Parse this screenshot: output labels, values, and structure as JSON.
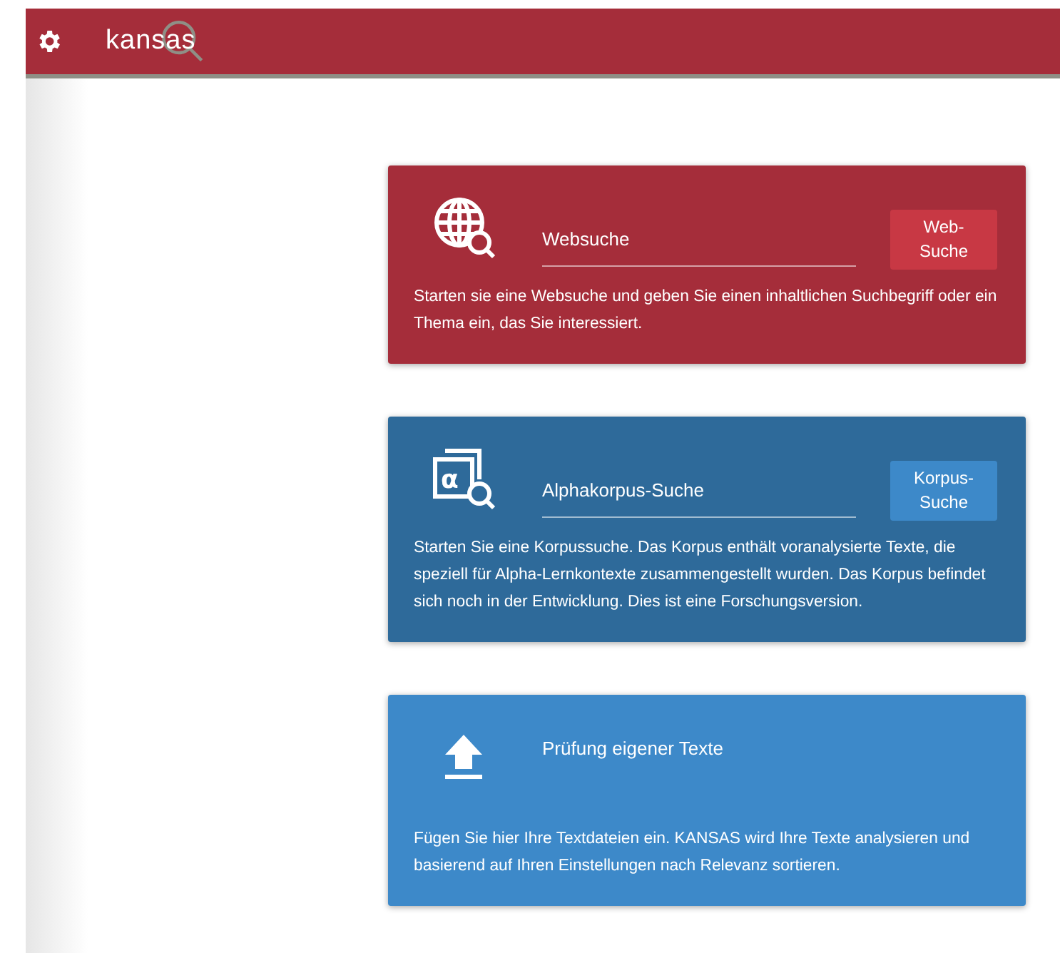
{
  "header": {
    "logo": "kansas"
  },
  "cards": [
    {
      "kind": "search",
      "color": "#a52d3a",
      "placeholder": "Websuche",
      "button": "Web-Suche",
      "description": "Starten sie eine Websuche und geben Sie einen inhaltlichen Suchbegriff oder ein Thema ein, das Sie interessiert."
    },
    {
      "kind": "search",
      "icon_text": "α",
      "color": "#2e6a9a",
      "placeholder": "Alphakorpus-Suche",
      "button": "Korpus-Suche",
      "description": "Starten Sie eine Korpussuche. Das Korpus enthält voranalysierte Texte, die speziell für Alpha-Lernkontexte zusammengestellt wurden. Das Korpus befindet sich noch in der Entwicklung. Dies ist eine Forschungsversion."
    },
    {
      "kind": "upload",
      "color": "#3d89c9",
      "title": "Prüfung eigener Texte",
      "description": "Fügen Sie hier Ihre Textdateien ein. KANSAS wird Ihre Texte analysieren und basierend auf Ihren Einstellungen nach Relevanz sortieren."
    }
  ]
}
